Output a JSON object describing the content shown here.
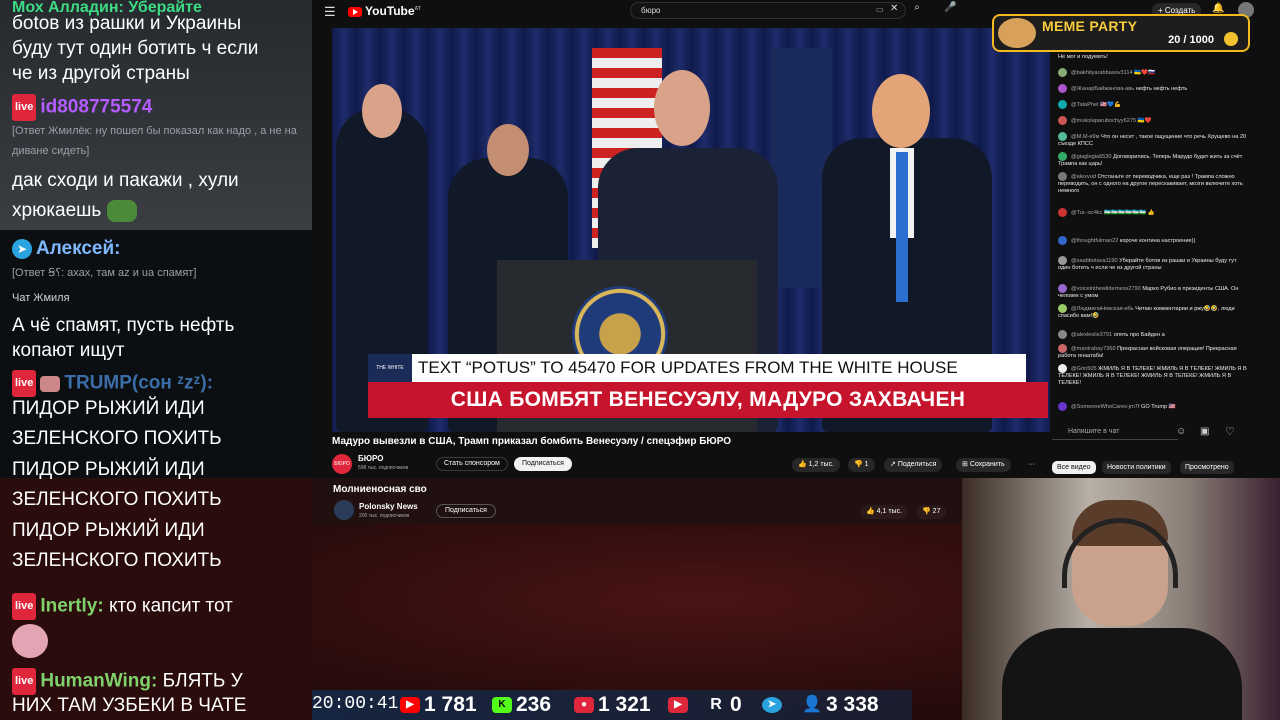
{
  "left_chat": {
    "msg1": "боtов из рашки и Украины буду тут один ботить ч если че из другой страны",
    "msg1a": "боtов из рашки и Украины",
    "msg1b": "буду тут один ботить ч если",
    "msg1c": "че из другой страны",
    "user2": "id808775574",
    "reply2": "[Ответ Жмилёк: ну пошел бы показал как надо , а не на диване сидеть]",
    "msg2a": "дак сходи и пакажи , хули",
    "msg2b": "хрюкаешь",
    "user3": "Алексей:",
    "reply3": "[Ответ Ꞩ⸮: ахах, там az и ua спамят]",
    "chat_label": "Чат Жмиля",
    "msg3a": "А чё спамят, пусть нефть",
    "msg3b": "копают ищут",
    "user4": "TRUMP(сон ᶻzᶻ):",
    "user4_tag": "NASRAL",
    "msg4": [
      "ПИДОР РЫЖИЙ ИДИ",
      "ЗЕЛЕНСКОГО ПОХИТЬ",
      "ПИДОР РЫЖИЙ ИДИ",
      "ЗЕЛЕНСКОГО ПОХИТЬ",
      "ПИДОР РЫЖИЙ ИДИ",
      "ЗЕЛЕНСКОГО ПОХИТЬ"
    ],
    "user5": "Inertly:",
    "msg5": "кто капсит тот",
    "user6": "HumanWing:",
    "msg6a": "БЛЯТЬ У",
    "msg6b": "НИХ ТАМ УЗБЕКИ В ЧАТЕ",
    "live_badge": "live"
  },
  "youtube": {
    "logo": "YouTube",
    "logo_suffix": "AT",
    "search_query": "бюро",
    "create_label": "+ Создать",
    "chyron_top": "TEXT “POTUS” TO 45470 FOR UPDATES FROM THE WHITE HOUSE",
    "chyron_main": "США БОМБЯТ ВЕНЕСУЭЛУ, МАДУРО ЗАХВАЧЕН",
    "video_title": "Мадуро вывезли в США, Трамп приказал бомбить Венесуэлу / спецэфир БЮРО",
    "channel_name": "БЮРО",
    "channel_avatar": "БЮРО",
    "channel_subs": "598 тыс. подписчиков",
    "sponsor_label": "Стать спонсором",
    "subscribe_label": "Подписаться",
    "likes": "1,2 тыс.",
    "dislikes": "1",
    "share_label": "Поделиться",
    "save_label": "Сохранить",
    "more_label": "···",
    "chips": [
      "Все видео",
      "Новости политики",
      "Просмотрено"
    ],
    "chat_placeholder": "Напишите в чат"
  },
  "yt_chat": [
    {
      "nick": "",
      "text": "Не мог и подумать!"
    },
    {
      "nick": "@bakhtiyarabbasov3114",
      "text": "🇺🇦❤️🇷🇺"
    },
    {
      "nick": "@ЖанарБайжанова-авь",
      "text": "нефть нефть нефть"
    },
    {
      "nick": "@TataPhel",
      "text": "🇺🇸💙💪"
    },
    {
      "nick": "@mukolaparubochyy6275",
      "text": "🇺🇦❤️"
    },
    {
      "nick": "@M.M-и9м",
      "text": "Что он несет , такое ощущение что речь Хрущево на 20 съезде КПСС"
    },
    {
      "nick": "@giaglegia6530",
      "text": "Договорились. Теперь Марудо будет жить за счёт Трампа как царь!"
    },
    {
      "nick": "@alexvud",
      "text": "Отстаньте от переводчика, еще раз ! Трампа сложно переводить, он с одного на другое перескакивает, мозги включите хоть немного"
    },
    {
      "nick": "@Tur.-oc4kc",
      "text": "🇺🇿🇺🇿🇺🇿🇺🇿🇺🇿🇺🇿 👍"
    },
    {
      "nick": "@thoughtfulman22",
      "text": "короче контина настроение))"
    },
    {
      "nick": "@saabbotava1190",
      "text": "Уберайте ботов из рашки и Украины буду тут один ботить ч если че из другой страны"
    },
    {
      "nick": "@voiceinthewilderness2790",
      "text": "Марко Рубио в президенты США. Он человек с умом"
    },
    {
      "nick": "@ЛюдмилаНевская-ибь",
      "text": "Читаю комментарии и ржу🤣🤣, люди спасибо вам!🤣"
    },
    {
      "nick": "@alexleslie3791",
      "text": "опять про Байден а"
    },
    {
      "nick": "@mantrabay7360",
      "text": "Прекрасная войсковая операция! Прекрасная работа генштаба!"
    },
    {
      "nick": "@Grin505",
      "text": "ЖМИЛЬ Я В ТЕЛЕКЕ! ЖМИЛЬ Я В ТЕЛЕКЕ! ЖМИЛЬ Я В ТЕЛЕКЕ! ЖМИЛЬ Я В ТЕЛЕКЕ! ЖМИЛЬ Я В ТЕЛЕКЕ! ЖМИЛЬ Я В ТЕЛЕКЕ!"
    },
    {
      "nick": "@SomeoneWhoCares-jm7f",
      "text": "GO Trump 🇺🇸"
    }
  ],
  "meme_party": {
    "title": "MEME PARTY",
    "score": "20 / 1000"
  },
  "yt2": {
    "title": "Молниеносная сво",
    "channel": "Polonsky News",
    "subs": "200 тыс. подписчиков",
    "subscribe_label": "Подписаться",
    "likes": "4,1 тыс.",
    "dislikes": "27"
  },
  "stats": {
    "time": "20:00:41",
    "youtube": "1 781",
    "kick": "236",
    "vk": "1 321",
    "rutube": "0",
    "telegram": "",
    "viewers": "3 338",
    "kick_icon": "K",
    "r_icon": "R",
    "r_value": "0"
  },
  "colors": {
    "chyron_red": "#c5142c",
    "live_red": "#e0263a",
    "telegram_blue": "#2aa3df",
    "kick_green": "#53fc18",
    "meme_gold": "#f4b821"
  }
}
